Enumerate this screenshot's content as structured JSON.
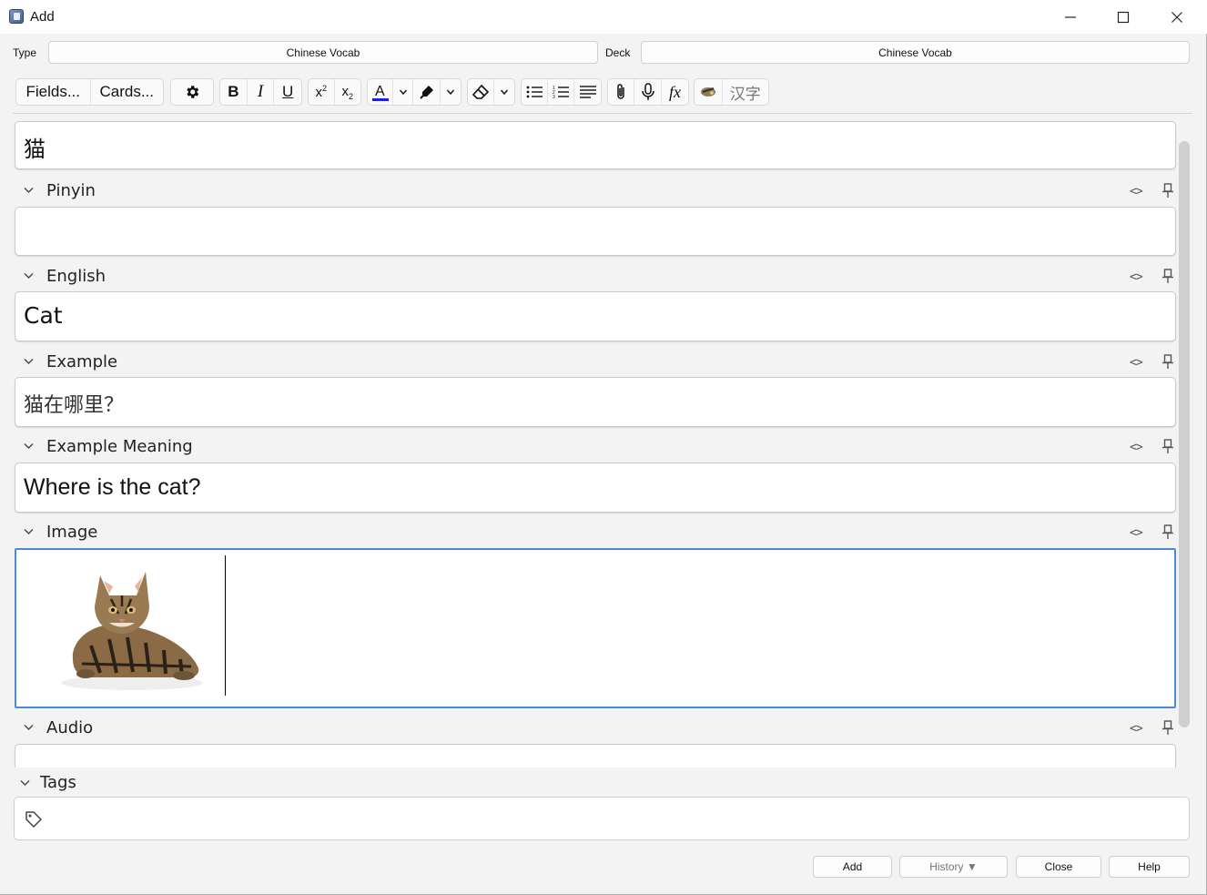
{
  "window": {
    "title": "Add",
    "minimize_icon": "minimize-icon",
    "maximize_icon": "maximize-icon",
    "close_icon": "close-icon"
  },
  "header": {
    "type_label": "Type",
    "type_value": "Chinese Vocab",
    "deck_label": "Deck",
    "deck_value": "Chinese Vocab"
  },
  "toolbar": {
    "fields_label": "Fields...",
    "cards_label": "Cards...",
    "hanzi_label": "汉字",
    "icons": [
      "gear-icon",
      "bold-icon",
      "italic-icon",
      "underline-icon",
      "superscript-icon",
      "subscript-icon",
      "text-color-icon",
      "highlight-icon",
      "eraser-icon",
      "bullet-list-icon",
      "numbered-list-icon",
      "align-icon",
      "attach-icon",
      "microphone-icon",
      "formula-icon",
      "addon-icon"
    ],
    "text_color": "#1a1aff"
  },
  "fields": [
    {
      "name": "",
      "value": "猫"
    },
    {
      "name": "Pinyin",
      "value": ""
    },
    {
      "name": "English",
      "value": "Cat"
    },
    {
      "name": "Example",
      "value": "猫在哪里？"
    },
    {
      "name": "Example Meaning",
      "value": "Where is the cat?"
    },
    {
      "name": "Image",
      "value": "",
      "image": "tabby-cat-photo"
    },
    {
      "name": "Audio",
      "value": ""
    }
  ],
  "field_controls": {
    "html_toggle": "<>",
    "pin_icon": "pin-icon"
  },
  "tags": {
    "label": "Tags",
    "icon": "tag-icon"
  },
  "buttons": {
    "add": "Add",
    "history": "History ▼",
    "close": "Close",
    "help": "Help"
  },
  "colors": {
    "focus_border": "#4a8ad8",
    "background": "#f3f3f3"
  }
}
